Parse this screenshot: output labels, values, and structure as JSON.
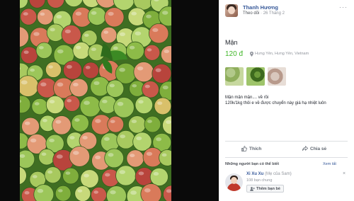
{
  "post": {
    "author": "Thanh Hương",
    "follow_label": "Theo dõi",
    "separator": "·",
    "date": "26 Tháng 2",
    "more_label": "···"
  },
  "listing": {
    "title": "Mận",
    "price": "120 đ",
    "location": "Hưng Yên, Hưng Yên, Vietnam",
    "description_line1": "Mận mận mận.... về rồi",
    "description_line2": "120k/1kg thôi e về được chuyển này giá hạ nhiệt luôn"
  },
  "actions": {
    "like_label": "Thích",
    "share_label": "Chia sẻ"
  },
  "suggestions": {
    "title": "Những người bạn có thể biết",
    "see_all": "Xem tất",
    "close_label": "×",
    "friend": {
      "name": "Xi Xu Xu",
      "relation": " (Mẹ của Sam)",
      "mutual": "108 bạn chung",
      "add_label": "Thêm bạn bè"
    }
  },
  "colors": {
    "link": "#365899",
    "price": "#42b72a",
    "muted": "#90949c"
  }
}
